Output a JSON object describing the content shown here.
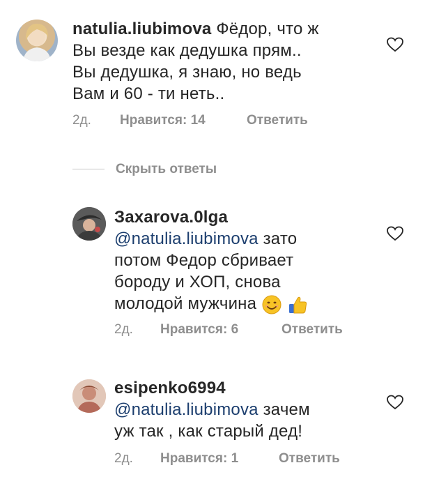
{
  "comments": [
    {
      "username": "natulia.liubimova",
      "lines": [
        "Фёдор, что ж",
        "Вы везде как дедушка  прям..",
        "Вы дедушка, я знаю, но ведь",
        "Вам и 60 - ти неть.."
      ],
      "time": "2д.",
      "likes": "Нравится: 14",
      "reply": "Ответить"
    },
    {
      "username": "Захаrova.0lga",
      "mention": "@natulia.liubimova",
      "lines": [
        " зато",
        "потом Федор сбривает",
        "бороду и ХОП, снова",
        "молодой мужчина"
      ],
      "time": "2д.",
      "likes": "Нравится: 6",
      "reply": "Ответить"
    },
    {
      "username": "esipenko6994",
      "mention": "@natulia.liubimova",
      "lines": [
        " зачем",
        "уж так , как старый дед!"
      ],
      "time": "2д.",
      "likes": "Нравится: 1",
      "reply": "Ответить"
    }
  ],
  "hide_replies": "Скрыть ответы",
  "icons": {
    "heart": "heart-outline-icon",
    "smile": "smiling-face-emoji",
    "thumbs": "thumbs-up-emoji"
  },
  "colors": {
    "text": "#262626",
    "meta": "#8e8e8e",
    "mention": "#1c3e6e"
  }
}
